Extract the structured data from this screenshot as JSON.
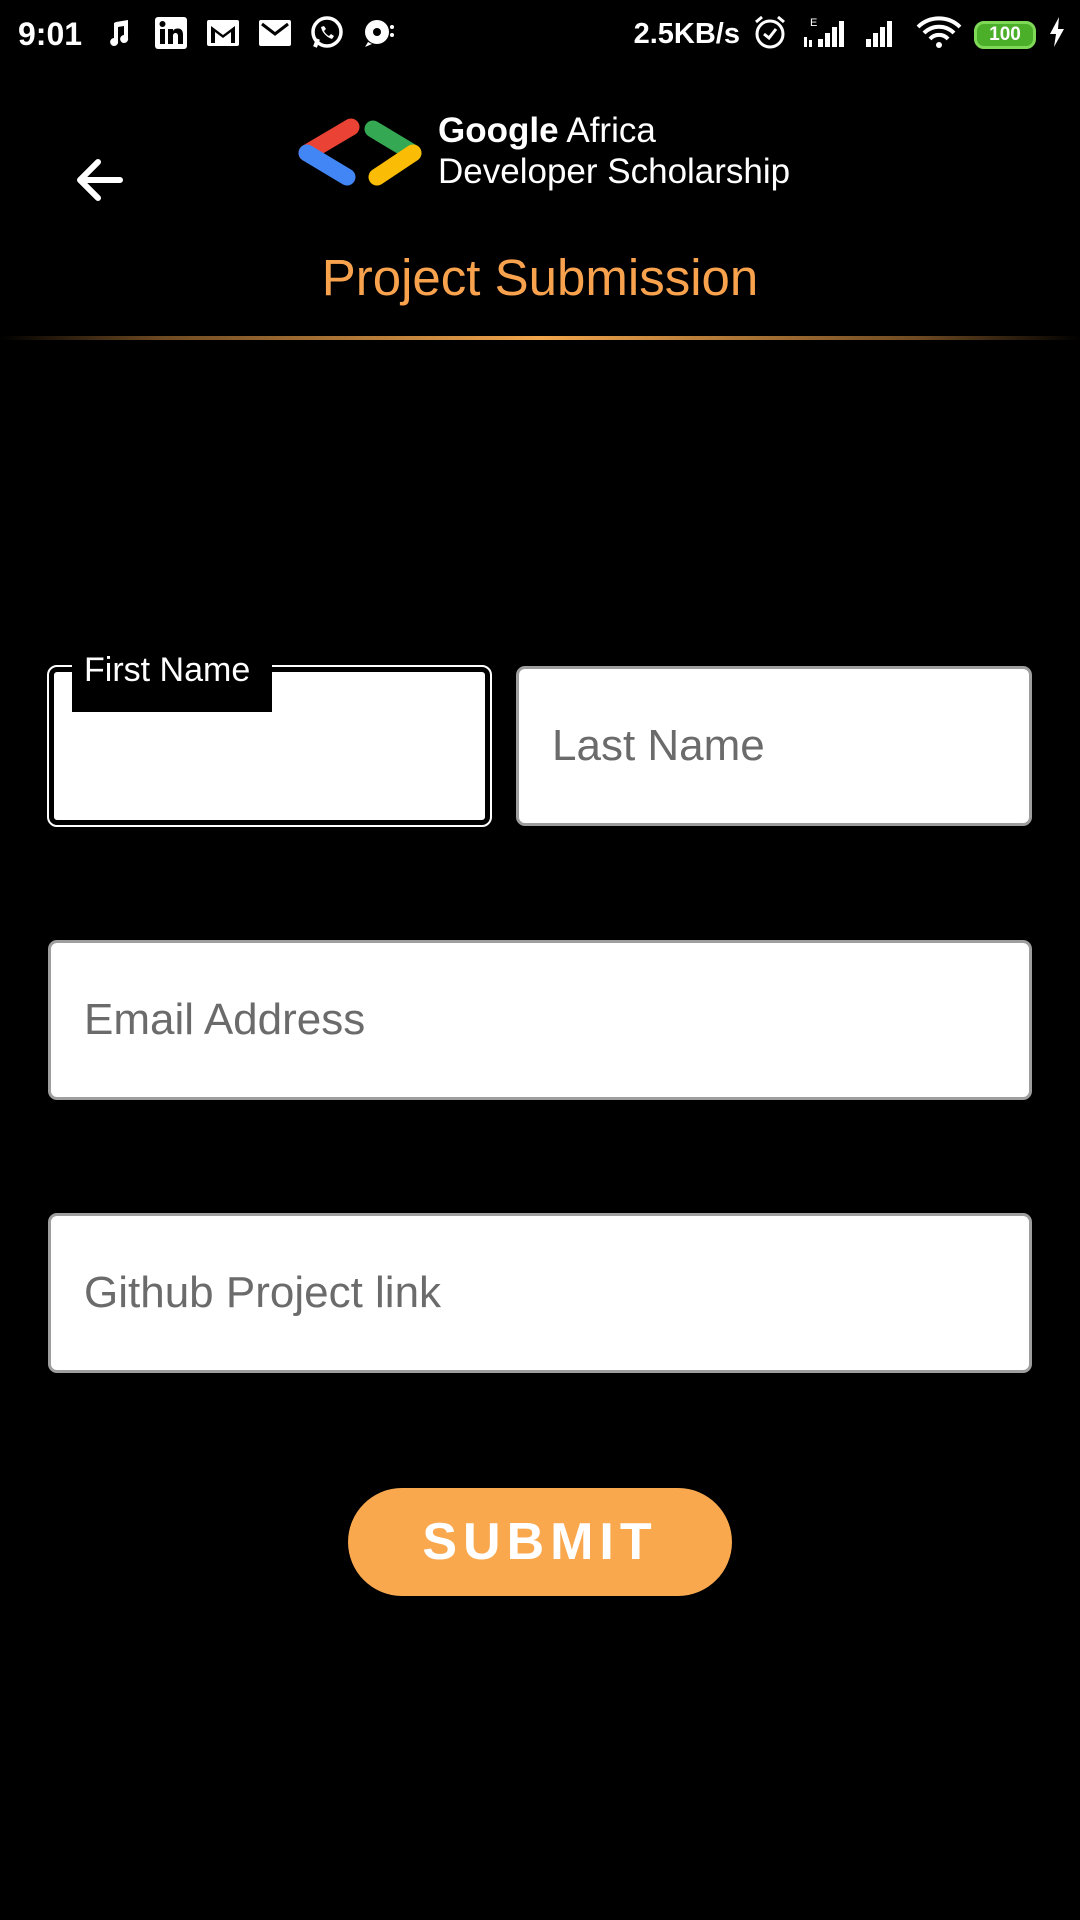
{
  "status_bar": {
    "time": "9:01",
    "net_speed": "2.5KB/s",
    "battery": "100",
    "left_icons": [
      "music-icon",
      "linkedin-icon",
      "gmail-icon",
      "gmail-icon",
      "whatsapp-icon",
      "chat-icon"
    ],
    "right_icons": [
      "alarm-icon",
      "signal-icon",
      "signal-icon",
      "wifi-icon",
      "battery-icon",
      "charging-icon"
    ]
  },
  "header": {
    "brand_line1_bold": "Google",
    "brand_line1_rest": " Africa",
    "brand_line2": "Developer Scholarship",
    "title": "Project Submission",
    "title_color": "#f9a24e"
  },
  "form": {
    "first_name": {
      "label": "First Name",
      "value": ""
    },
    "last_name": {
      "placeholder": "Last Name",
      "value": ""
    },
    "email": {
      "placeholder": "Email Address",
      "value": ""
    },
    "github": {
      "placeholder": "Github Project link",
      "value": ""
    },
    "submit_label": "SUBMIT",
    "accent": "#f9a84e"
  }
}
